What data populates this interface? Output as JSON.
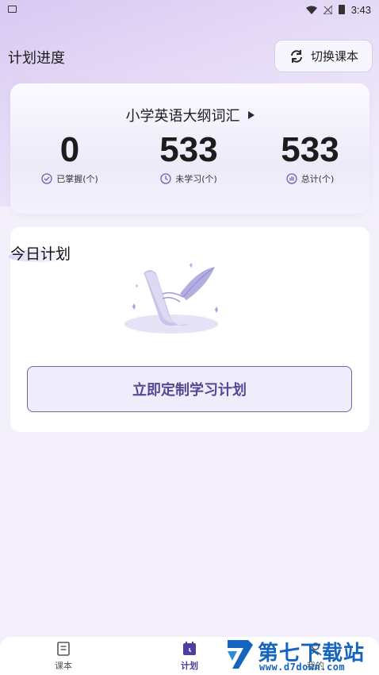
{
  "status_bar": {
    "time": "3:43"
  },
  "header": {
    "title": "计划进度",
    "switch_button_label": "切换课本",
    "switch_icon": "refresh-icon"
  },
  "progress_card": {
    "book_name": "小学英语大纲词汇",
    "stats": [
      {
        "value": "0",
        "label": "已掌握(个)",
        "icon": "check-circle-icon"
      },
      {
        "value": "533",
        "label": "未学习(个)",
        "icon": "clock-icon"
      },
      {
        "value": "533",
        "label": "总计(个)",
        "icon": "bar-chart-icon"
      }
    ]
  },
  "plan_card": {
    "title": "今日计划",
    "custom_plan_button_label": "立即定制学习计划"
  },
  "tab_bar": {
    "tabs": [
      {
        "label": "课本",
        "icon": "book-icon",
        "active": false
      },
      {
        "label": "计划",
        "icon": "calendar-icon",
        "active": true
      },
      {
        "label": "我的",
        "icon": "user-icon",
        "active": false
      }
    ]
  },
  "watermark": {
    "text": "第七下载站",
    "url": "www.d7down.com"
  },
  "colors": {
    "accent": "#4b3fa0",
    "button_text": "#524a92",
    "watermark": "#1565c0"
  }
}
